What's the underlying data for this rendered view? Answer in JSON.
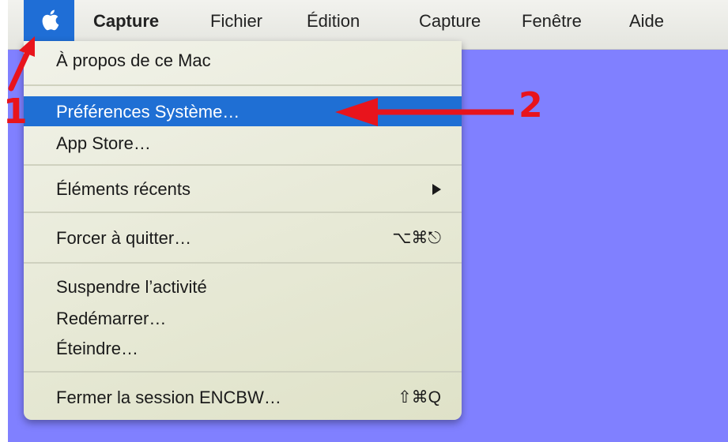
{
  "menubar": {
    "apple_menu": "apple-logo-icon",
    "items": [
      {
        "label": "Capture",
        "bold": true
      },
      {
        "label": "Fichier"
      },
      {
        "label": "Édition"
      },
      {
        "label": "Capture"
      },
      {
        "label": "Fenêtre"
      },
      {
        "label": "Aide"
      }
    ]
  },
  "apple_menu": {
    "about": "À propos de ce Mac",
    "system_prefs": "Préférences Système…",
    "app_store": "App Store…",
    "recent_items": "Éléments récents",
    "force_quit": "Forcer à quitter…",
    "force_quit_shortcut": "⌥⌘⎋",
    "sleep": "Suspendre l’activité",
    "restart": "Redémarrer…",
    "shutdown": "Éteindre…",
    "logout": "Fermer la session ENCBW…",
    "logout_shortcut": "⇧⌘Q"
  },
  "annotations": {
    "step1": "1",
    "step2": "2",
    "color": "#e8141c"
  },
  "colors": {
    "highlight": "#1f6fd4",
    "desktop": "#8080ff"
  }
}
